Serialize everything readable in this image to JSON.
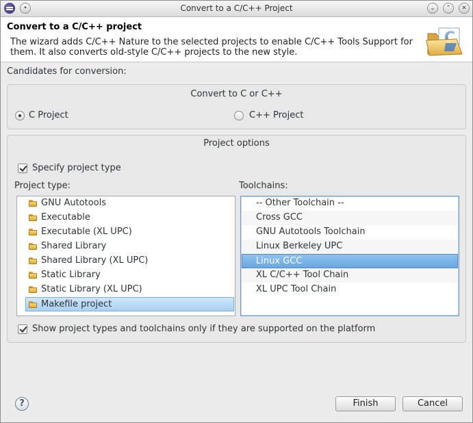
{
  "window": {
    "title": "Convert to a C/C++ Project",
    "controls": [
      "minimize-icon",
      "maximize-icon",
      "close-icon"
    ]
  },
  "header": {
    "title": "Convert to a C/C++ project",
    "description": "The wizard adds C/C++ Nature to the selected projects to enable C/C++ Tools Support for them. It also converts old-style C/C++ projects to the new style.",
    "icon": "convert-cpp-wizard-icon"
  },
  "candidates_label": "Candidates for conversion:",
  "convert_group": {
    "title": "Convert to C or C++",
    "c_label": "C Project",
    "cpp_label": "C++ Project",
    "selected": "C Project"
  },
  "options_group": {
    "title": "Project options",
    "specify_label": "Specify project type",
    "specify_checked": true,
    "project_type_label": "Project type:",
    "toolchains_label": "Toolchains:",
    "project_types": [
      "GNU Autotools",
      "Executable",
      "Executable (XL UPC)",
      "Shared Library",
      "Shared Library (XL UPC)",
      "Static Library",
      "Static Library (XL UPC)",
      "Makefile project"
    ],
    "selected_project_type": "Makefile project",
    "toolchains": [
      "-- Other Toolchain --",
      "Cross GCC",
      "GNU Autotools Toolchain",
      "Linux Berkeley UPC",
      "Linux GCC",
      "XL C/C++ Tool Chain",
      "XL UPC Tool Chain"
    ],
    "selected_toolchain": "Linux GCC",
    "show_supported_label": "Show project types and toolchains only if they are supported on the platform",
    "show_supported_checked": true
  },
  "footer": {
    "help": "?",
    "finish_label": "Finish",
    "cancel_label": "Cancel"
  },
  "colors": {
    "selection": "#6aa7e0",
    "header_bg": "#ffffff",
    "dialog_bg": "#ececec"
  }
}
